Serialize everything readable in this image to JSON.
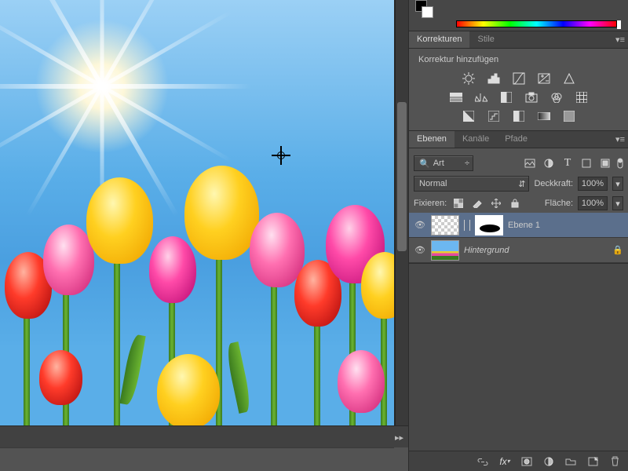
{
  "panels": {
    "corrections": {
      "tabs": [
        "Korrekturen",
        "Stile"
      ],
      "active_tab": 0,
      "header": "Korrektur hinzufügen",
      "icons_row1": [
        "brightness-contrast-icon",
        "levels-icon",
        "curves-icon",
        "exposure-icon",
        "vibrance-icon"
      ],
      "icons_row2": [
        "hue-sat-icon",
        "color-balance-icon",
        "bw-icon",
        "photo-filter-icon",
        "channel-mixer-icon",
        "lut-icon"
      ],
      "icons_row3": [
        "invert-icon",
        "posterize-icon",
        "threshold-icon",
        "gradient-map-icon",
        "selective-color-icon"
      ]
    },
    "layers": {
      "tabs": [
        "Ebenen",
        "Kanäle",
        "Pfade"
      ],
      "active_tab": 0,
      "filter_label": "Art",
      "filter_icons": [
        "filter-pixel-icon",
        "filter-adjust-icon",
        "filter-type-icon",
        "filter-shape-icon",
        "filter-smart-icon"
      ],
      "blend_mode": "Normal",
      "opacity_label": "Deckkraft:",
      "opacity_value": "100%",
      "lock_label": "Fixieren:",
      "lock_icons": [
        "lock-transparent-icon",
        "lock-paint-icon",
        "lock-move-icon",
        "lock-all-icon"
      ],
      "fill_label": "Fläche:",
      "fill_value": "100%",
      "layers_list": [
        {
          "name": "Ebene 1",
          "mask": true,
          "visible": true,
          "selected": true,
          "locked": false,
          "thumb": "checker"
        },
        {
          "name": "Hintergrund",
          "mask": false,
          "visible": true,
          "selected": false,
          "locked": true,
          "italic": true,
          "thumb": "image"
        }
      ],
      "toolbar_icons": [
        "link-icon",
        "fx-icon",
        "mask-add-icon",
        "adjustment-add-icon",
        "group-new-icon",
        "layer-new-icon",
        "trash-icon"
      ]
    }
  }
}
